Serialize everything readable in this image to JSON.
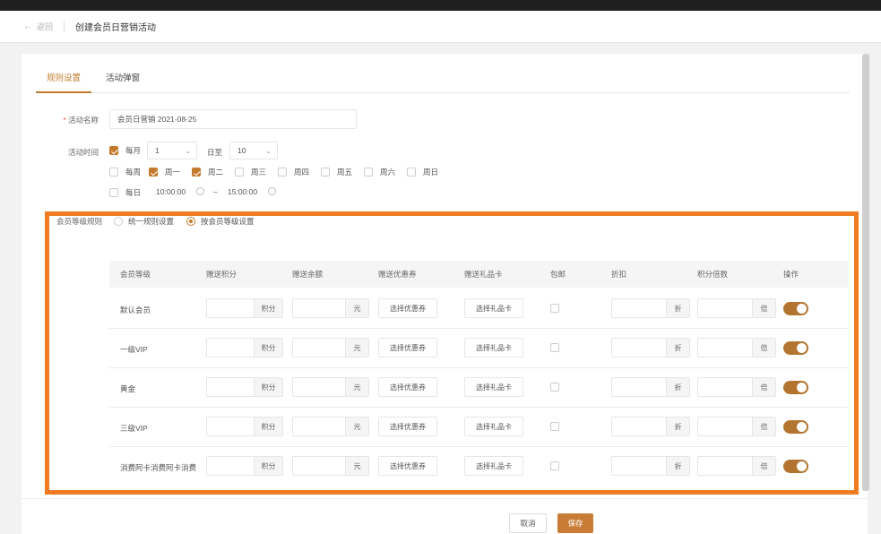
{
  "header": {
    "back_label": "返回",
    "title": "创建会员日营销活动"
  },
  "tabs": [
    {
      "label": "规则设置",
      "active": true
    },
    {
      "label": "活动弹窗",
      "active": false
    }
  ],
  "form": {
    "name_label": "活动名称",
    "name_value": "会员日营销  2021-08-25",
    "time_label": "活动时间",
    "monthly_label": "每月",
    "month_start": "1",
    "to_label": "日至",
    "month_end": "10",
    "weekly_label": "每周",
    "weekdays": [
      {
        "label": "周一",
        "checked": true
      },
      {
        "label": "周二",
        "checked": true
      },
      {
        "label": "周三",
        "checked": false
      },
      {
        "label": "周四",
        "checked": false
      },
      {
        "label": "周五",
        "checked": false
      },
      {
        "label": "周六",
        "checked": false
      },
      {
        "label": "周日",
        "checked": false
      }
    ],
    "daily_label": "每日",
    "time_start": "10:00:00",
    "time_dash": "–",
    "time_end": "15:00:00",
    "level_rule_label": "会员等级规则",
    "rule_unified": "统一规则设置",
    "rule_by_level": "按会员等级设置"
  },
  "table": {
    "headers": [
      "会员等级",
      "赠送积分",
      "赠送余额",
      "赠送优惠券",
      "赠送礼品卡",
      "包邮",
      "折扣",
      "积分倍数",
      "操作"
    ],
    "suffix_points": "积分",
    "suffix_yuan": "元",
    "coupon_btn": "选择优惠券",
    "giftcard_btn": "选择礼品卡",
    "suffix_discount": "折",
    "suffix_times": "倍",
    "rows": [
      {
        "name": "默认会员"
      },
      {
        "name": "一级VIP"
      },
      {
        "name": "黄金"
      },
      {
        "name": "三级VIP"
      },
      {
        "name": "消费阿卡消费阿卡消费"
      }
    ]
  },
  "footer": {
    "cancel": "取消",
    "save": "保存"
  },
  "colors": {
    "accent": "#c27a2e",
    "highlight": "#f07b22"
  }
}
